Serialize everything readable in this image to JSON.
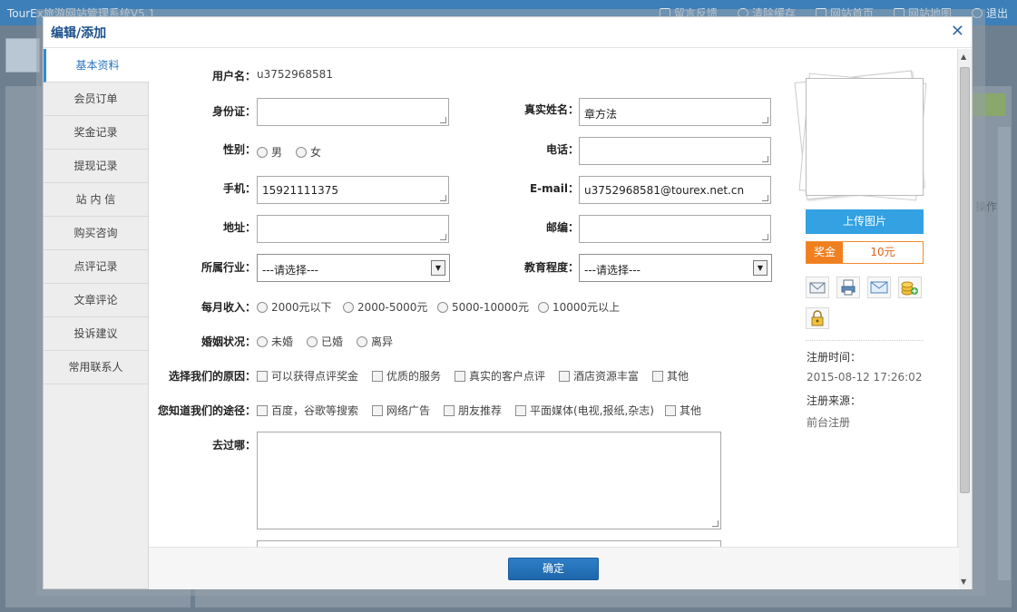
{
  "background": {
    "app_title": "TourEx旅游网站管理系统V5.1",
    "nav": [
      "留言反馈",
      "清除缓存",
      "网站首页",
      "网站地图",
      "退出"
    ],
    "ops_label": "操作"
  },
  "modal": {
    "title": "编辑/添加",
    "close": "✕",
    "confirm": "确定"
  },
  "tabs": [
    "基本资料",
    "会员订单",
    "奖金记录",
    "提现记录",
    "站 内 信",
    "购买咨询",
    "点评记录",
    "文章评论",
    "投诉建议",
    "常用联系人"
  ],
  "form": {
    "username_label": "用户名：",
    "username_value": "u3752968581",
    "id_card_label": "身份证：",
    "id_card_value": "",
    "real_name_label": "真实姓名：",
    "real_name_value": "章方法",
    "gender_label": "性别：",
    "gender_options": [
      "男",
      "女"
    ],
    "phone_label": "电话：",
    "phone_value": "",
    "mobile_label": "手机：",
    "mobile_value": "15921111375",
    "email_label": "E-mail：",
    "email_value": "u3752968581@tourex.net.cn",
    "address_label": "地址：",
    "address_value": "",
    "postcode_label": "邮编：",
    "postcode_value": "",
    "industry_label": "所属行业：",
    "industry_value": "---请选择---",
    "education_label": "教育程度：",
    "education_value": "---请选择---",
    "income_label": "每月收入：",
    "income_options": [
      "2000元以下",
      "2000-5000元",
      "5000-10000元",
      "10000元以上"
    ],
    "marital_label": "婚姻状况：",
    "marital_options": [
      "未婚",
      "已婚",
      "离异"
    ],
    "reason_label": "选择我们的原因：",
    "reason_options": [
      "可以获得点评奖金",
      "优质的服务",
      "真实的客户点评",
      "酒店资源丰富",
      "其他"
    ],
    "source_label": "您知道我们的途径：",
    "source_options": [
      "百度，谷歌等搜索",
      "网络广告",
      "朋友推荐",
      "平面媒体(电视,报纸,杂志)",
      "其他"
    ],
    "visited_label": "去过哪："
  },
  "profile": {
    "upload_label": "上传图片",
    "bonus_key": "奖金",
    "bonus_value": "10元",
    "icons": [
      "mail-icon",
      "print-icon",
      "message-icon",
      "add-coins-icon",
      "lock-icon"
    ],
    "reg_time_label": "注册时间：",
    "reg_time_value": "2015-08-12 17:26:02",
    "reg_source_label": "注册来源：",
    "reg_source_value": "前台注册"
  }
}
